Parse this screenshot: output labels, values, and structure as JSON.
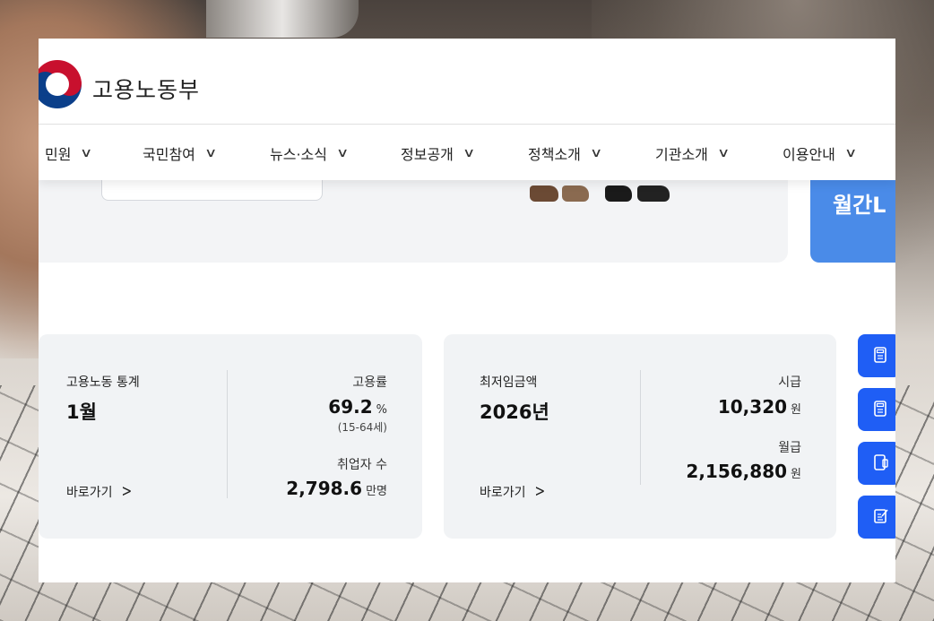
{
  "header": {
    "brand_name": "고용노동부"
  },
  "nav": {
    "items": [
      {
        "label": "민원"
      },
      {
        "label": "국민참여"
      },
      {
        "label": "뉴스·소식"
      },
      {
        "label": "정보공개"
      },
      {
        "label": "정책소개"
      },
      {
        "label": "기관소개"
      },
      {
        "label": "이용안내"
      }
    ],
    "chevron_icon": "chevron-down-icon"
  },
  "banner": {
    "blue_card_text": "월간L"
  },
  "stats_card": {
    "title": "고용노동 통계",
    "period": "1월",
    "link_label": "바로가기",
    "employment_rate_label": "고용률",
    "employment_rate_value": "69.2",
    "employment_rate_unit": "%",
    "employment_rate_note": "(15-64세)",
    "employed_label": "취업자 수",
    "employed_value": "2,798.6",
    "employed_unit": "만명"
  },
  "min_wage_card": {
    "title": "최저임금액",
    "year": "2026년",
    "link_label": "바로가기",
    "hourly_label": "시급",
    "hourly_value": "10,320",
    "hourly_unit": "원",
    "monthly_label": "월급",
    "monthly_value": "2,156,880",
    "monthly_unit": "원"
  },
  "quick_buttons": [
    {
      "icon": "calculator-icon"
    },
    {
      "icon": "calculator-icon"
    },
    {
      "icon": "tablet-icon"
    },
    {
      "icon": "edit-document-icon"
    }
  ],
  "colors": {
    "accent_blue": "#1f5ef5",
    "banner_blue": "#4a8be8",
    "card_bg": "#f1f3f5"
  }
}
